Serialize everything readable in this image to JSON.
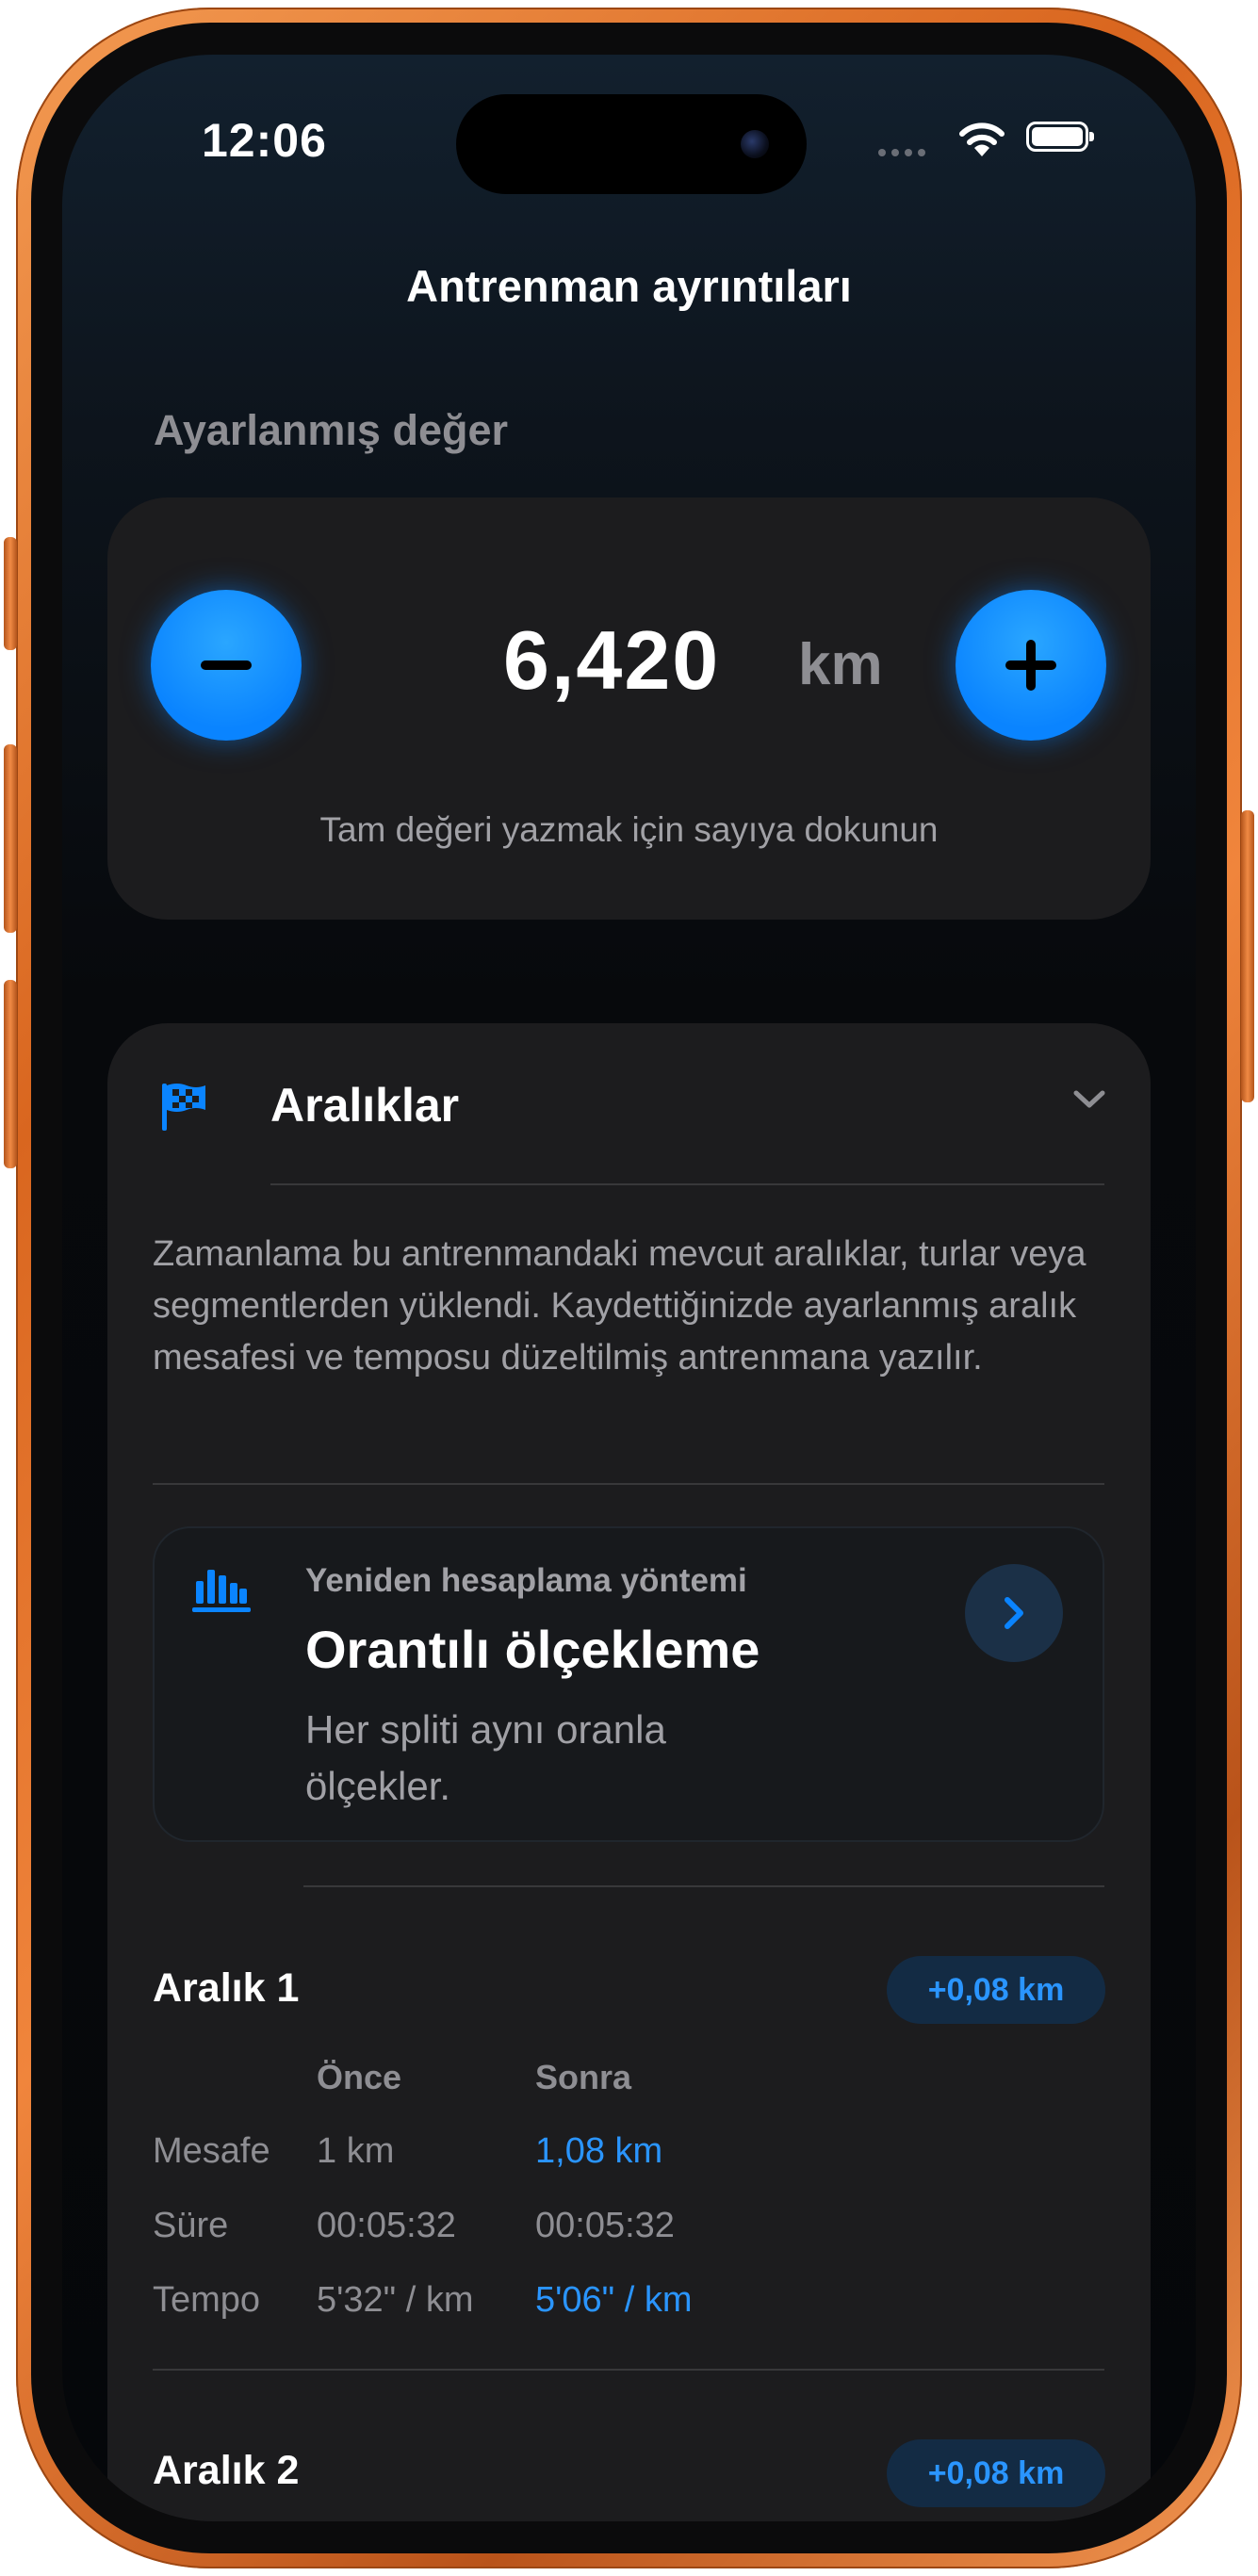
{
  "status_bar": {
    "time": "12:06"
  },
  "nav": {
    "title": "Antrenman ayrıntıları"
  },
  "adjusted": {
    "section_label": "Ayarlanmış değer",
    "value": "6,420",
    "unit": "km",
    "hint": "Tam değeri yazmak için sayıya dokunun"
  },
  "intervals": {
    "title": "Aralıklar",
    "description": "Zamanlama bu antrenmandaki mevcut aralıklar, turlar veya segmentlerden yüklendi. Kaydettiğinizde ayarlanmış aralık mesafesi ve temposu düzeltilmiş antrenmana yazılır.",
    "method": {
      "label": "Yeniden hesaplama yöntemi",
      "title": "Orantılı ölçekleme",
      "description": "Her spliti aynı oranla ölçekler."
    },
    "columns": {
      "before": "Önce",
      "after": "Sonra"
    },
    "items": [
      {
        "title": "Aralık 1",
        "delta": "+0,08 km",
        "rows": [
          {
            "label": "Mesafe",
            "before": "1 km",
            "after": "1,08 km",
            "changed": true
          },
          {
            "label": "Süre",
            "before": "00:05:32",
            "after": "00:05:32",
            "changed": false
          },
          {
            "label": "Tempo",
            "before": "5'32\" / km",
            "after": "5'06\" / km",
            "changed": true
          }
        ]
      },
      {
        "title": "Aralık 2",
        "delta": "+0,08 km"
      }
    ]
  },
  "colors": {
    "accent": "#0A84FF",
    "card": "#1C1C1E",
    "frame": "#E67A32"
  }
}
